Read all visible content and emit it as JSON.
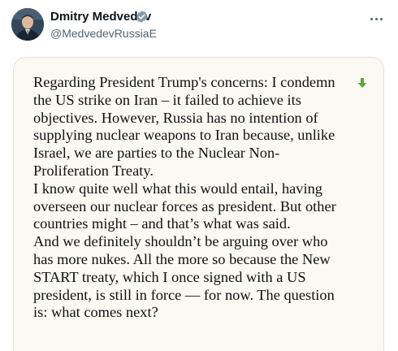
{
  "author": {
    "name": "Dmitry Medvedev",
    "handle": "@MedvedevRussiaE",
    "verified": true,
    "verified_color": "#829aab"
  },
  "header": {
    "more_icon": "more-horizontal-icon"
  },
  "statement": {
    "lines": [
      "Regarding President Trump's concerns: I condemn",
      "the US strike on Iran – it failed to achieve its",
      "objectives. However, Russia has no intention of",
      "supplying nuclear weapons to Iran because, unlike",
      "Israel, we are parties to the Nuclear Non-",
      "Proliferation Treaty.",
      "I know quite well what this would entail, having",
      "overseen our nuclear forces as president. But other",
      "countries might – and that’s what was said.",
      "And we definitely shouldn’t be arguing over who",
      "has more nukes. All the more so because the New",
      "START treaty, which I once signed with a US",
      "president, is still in force — for now. The question",
      "is: what comes next?"
    ],
    "paper_color": "#fbf9f1",
    "arrow_icon": "green-down-arrow-icon",
    "arrow_color": "#5aa832"
  }
}
